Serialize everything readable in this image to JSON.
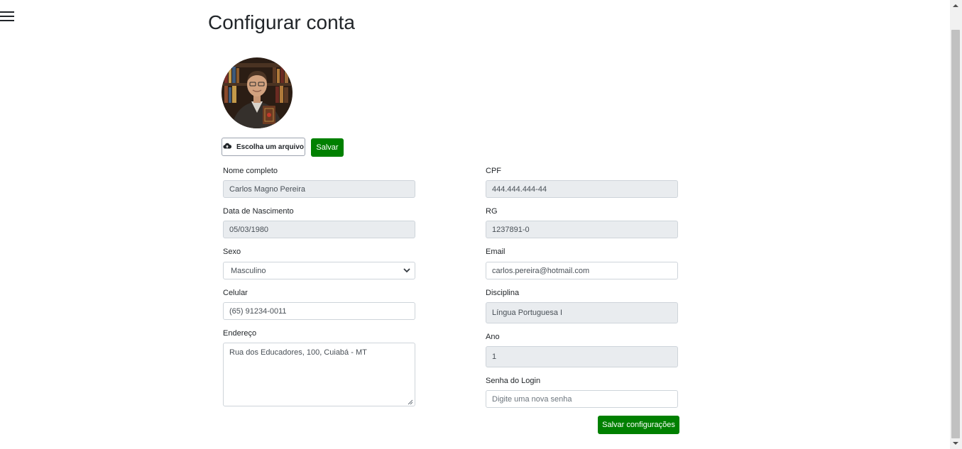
{
  "page": {
    "title": "Configurar conta"
  },
  "menu": {
    "icon": "hamburger-menu-icon"
  },
  "photo": {
    "upload_label": "Escolha um arquivo",
    "upload_icon": "cloud-upload-icon",
    "save_label": "Salvar"
  },
  "form": {
    "nome": {
      "label": "Nome completo",
      "value": "Carlos Magno Pereira"
    },
    "cpf": {
      "label": "CPF",
      "value": "444.444.444-44"
    },
    "nascimento": {
      "label": "Data de Nascimento",
      "value": "05/03/1980"
    },
    "rg": {
      "label": "RG",
      "value": "1237891-0"
    },
    "sexo": {
      "label": "Sexo",
      "value": "Masculino"
    },
    "email": {
      "label": "Email",
      "value": "carlos.pereira@hotmail.com"
    },
    "celular": {
      "label": "Celular",
      "value": "(65) 91234-0011"
    },
    "disciplina": {
      "label": "Disciplina",
      "value": "Língua Portuguesa I"
    },
    "endereco": {
      "label": "Endereço",
      "value": "Rua dos Educadores, 100, Cuiabá - MT"
    },
    "ano": {
      "label": "Ano",
      "value": "1"
    },
    "senha": {
      "label": "Senha do Login",
      "placeholder": "Digite uma nova senha"
    },
    "submit_label": "Salvar configurações"
  },
  "colors": {
    "accent": "#008000",
    "readonly_bg": "#e9ecef",
    "border": "#ced4da"
  }
}
